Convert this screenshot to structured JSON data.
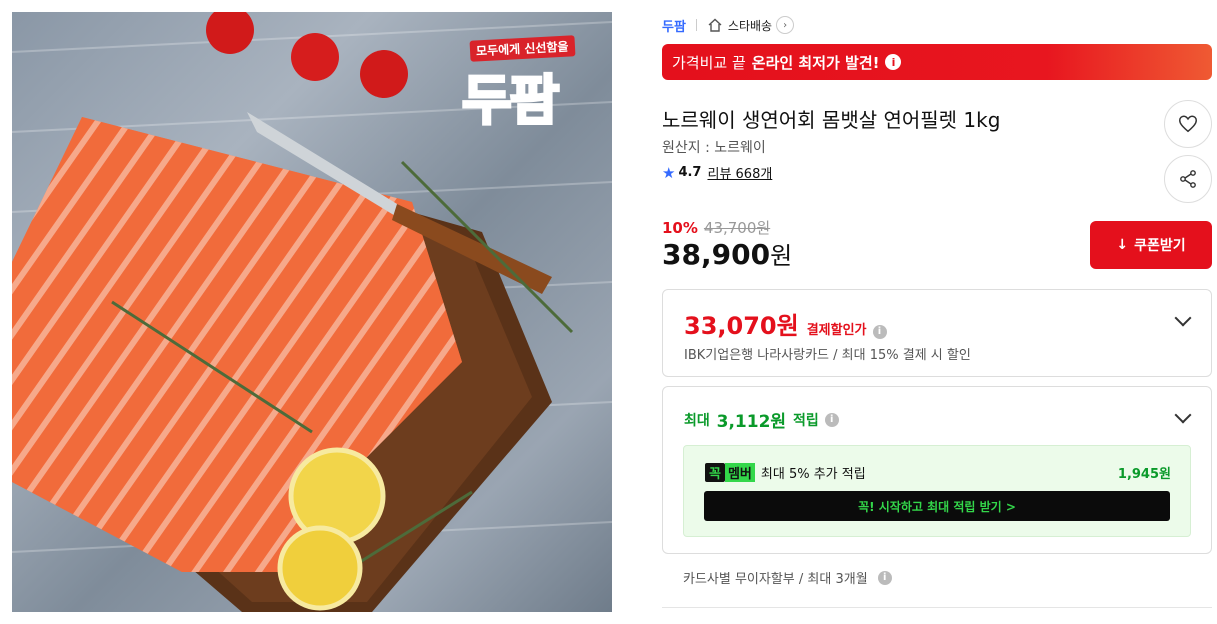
{
  "image": {
    "brand_tag": "모두에게 신선함을",
    "brand_logo": "두팜"
  },
  "breadcrumb": {
    "brand": "두팜",
    "shipping": "스타배송"
  },
  "promo": {
    "prefix": "가격비교 끝",
    "highlight": "온라인 최저가 발견!"
  },
  "product": {
    "title": "노르웨이 생연어회 몸뱃살 연어필렛 1kg",
    "origin": "원산지 : 노르웨이",
    "rating": "4.7",
    "reviews": "리뷰 668개"
  },
  "price": {
    "discount_rate": "10%",
    "original": "43,700원",
    "sale": "38,900",
    "sale_unit": "원",
    "coupon_label": "쿠폰받기"
  },
  "card_benefit": {
    "amount": "33,070원",
    "label": "결제할인가",
    "description": "IBK기업은행 나라사랑카드 / 최대 15% 결제 시 할인"
  },
  "points": {
    "prefix": "최대",
    "amount": "3,112원",
    "suffix": "적립",
    "member_logo_1": "꼭",
    "member_logo_2": "멤버",
    "member_text": "최대 5% 추가 적립",
    "member_amount": "1,945원",
    "member_cta": "꼭! 시작하고 최대 적립 받기  >"
  },
  "installment": {
    "text": "카드사별 무이자할부 / 최대 3개월"
  },
  "colors": {
    "accent_red": "#e4101c",
    "brand_blue": "#346aff",
    "point_green": "#0a9a2a",
    "member_green": "#33d74a"
  },
  "icons": {
    "info": "i",
    "star": "★",
    "download": "↓"
  }
}
